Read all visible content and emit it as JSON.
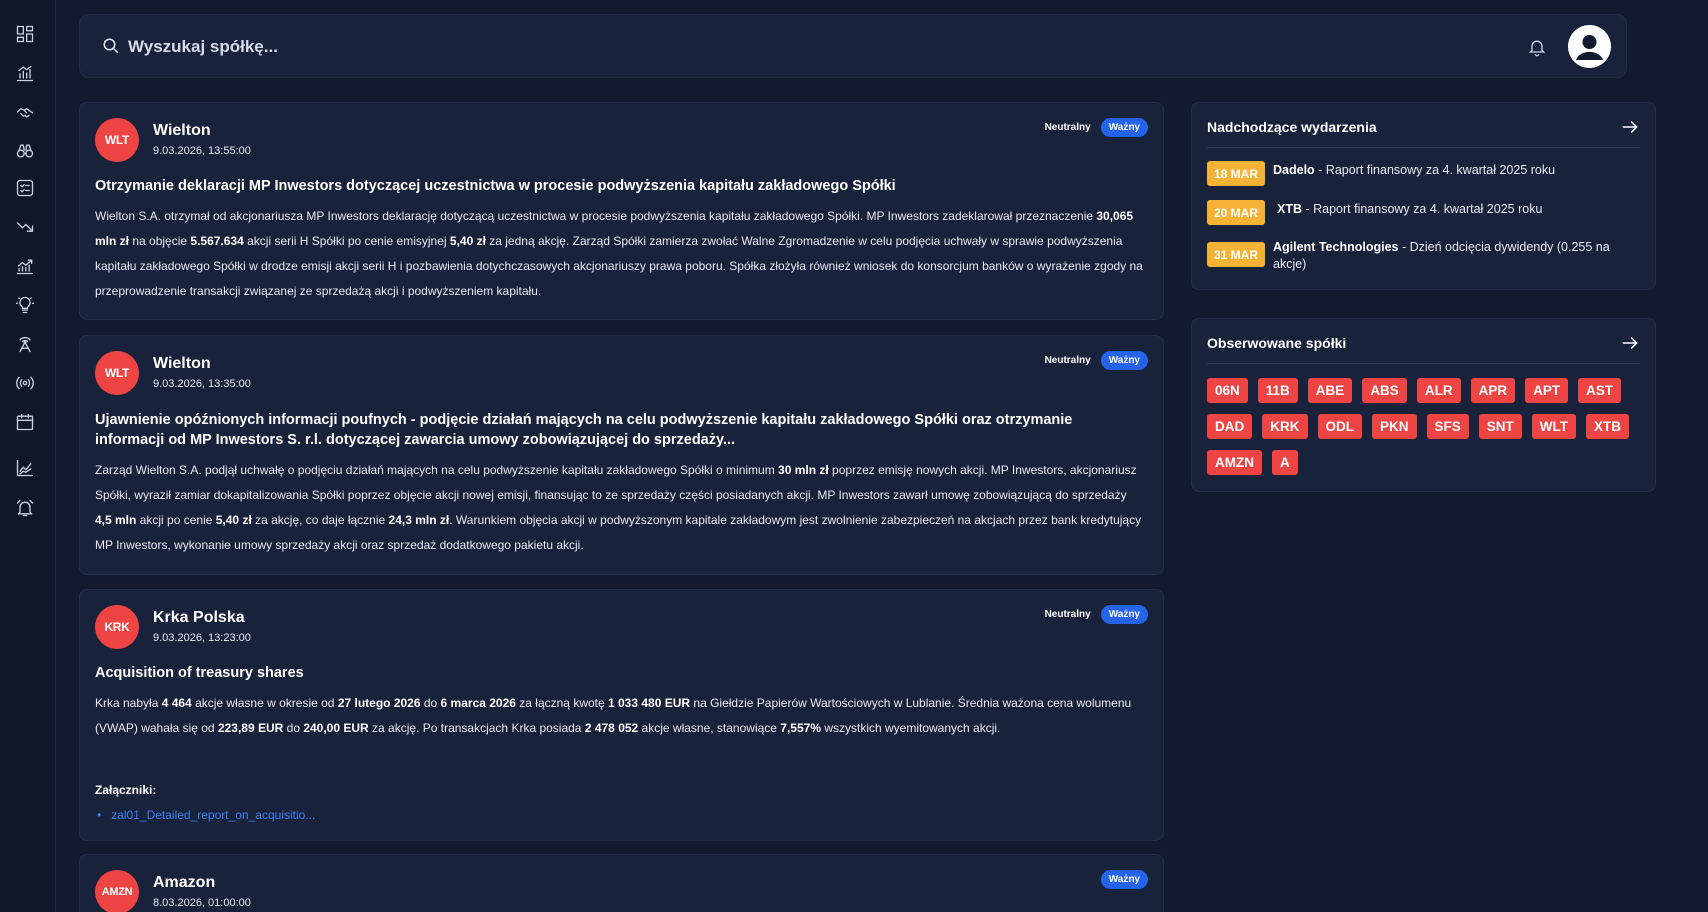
{
  "search": {
    "placeholder": "Wyszukaj spółkę..."
  },
  "sidebar": {
    "icons": [
      "dashboard-icon",
      "bar-chart-icon",
      "handshake-icon",
      "binoculars-icon",
      "checklist-icon",
      "trend-down-icon",
      "trend-up-icon",
      "lightbulb-icon",
      "radar-tower-icon",
      "broadcast-icon",
      "calendar-icon",
      "area-chart-icon",
      "bell-alarm-icon"
    ]
  },
  "feed": [
    {
      "logo": "WLT",
      "company": "Wielton",
      "date": "9.03.2026, 13:55:00",
      "sentiment": "Neutralny",
      "importance": "Ważny",
      "title": "Otrzymanie deklaracji MP Inwestors dotyczącej uczestnictwa w procesie podwyższenia kapitału zakładowego Spółki",
      "body": [
        {
          "t": "Wielton S.A. otrzymał od akcjonariusza MP Inwestors deklarację dotyczącą uczestnictwa w procesie podwyższenia kapitału zakładowego Spółki. MP Inwestors zadeklarował przeznaczenie ",
          "b": false
        },
        {
          "t": "30,065 mln zł",
          "b": true
        },
        {
          "t": " na objęcie ",
          "b": false
        },
        {
          "t": "5.567.634",
          "b": true
        },
        {
          "t": " akcji serii H Spółki po cenie emisyjnej ",
          "b": false
        },
        {
          "t": "5,40 zł",
          "b": true
        },
        {
          "t": " za jedną akcję. Zarząd Spółki zamierza zwołać Walne Zgromadzenie w celu podjęcia uchwały w sprawie podwyższenia kapitału zakładowego Spółki w drodze emisji akcji serii H i pozbawienia dotychczasowych akcjonariuszy prawa poboru. Spółka złożyła również wniosek do konsorcjum banków o wyrażenie zgody na przeprowadzenie transakcji związanej ze sprzedażą akcji i podwyższeniem kapitału.",
          "b": false
        }
      ]
    },
    {
      "logo": "WLT",
      "company": "Wielton",
      "date": "9.03.2026, 13:35:00",
      "sentiment": "Neutralny",
      "importance": "Ważny",
      "title": "Ujawnienie opóźnionych informacji poufnych - podjęcie działań mających na celu podwyższenie kapitału zakładowego Spółki oraz otrzymanie informacji od MP Inwestors S. r.l. dotyczącej zawarcia umowy zobowiązującej do sprzedaży...",
      "body": [
        {
          "t": "Zarząd Wielton S.A. podjął uchwałę o podjęciu działań mających na celu podwyższenie kapitału zakładowego Spółki o minimum ",
          "b": false
        },
        {
          "t": "30 mln zł",
          "b": true
        },
        {
          "t": " poprzez emisję nowych akcji. MP Inwestors, akcjonariusz Spółki, wyraził zamiar dokapitalizowania Spółki poprzez objęcie akcji nowej emisji, finansując to ze sprzedaży części posiadanych akcji. MP Inwestors zawarł umowę zobowiązującą do sprzedaży ",
          "b": false
        },
        {
          "t": "4,5 mln",
          "b": true
        },
        {
          "t": " akcji po cenie ",
          "b": false
        },
        {
          "t": "5,40 zł",
          "b": true
        },
        {
          "t": " za akcję, co daje łącznie ",
          "b": false
        },
        {
          "t": "24,3 mln zł",
          "b": true
        },
        {
          "t": ". Warunkiem objęcia akcji w podwyższonym kapitale zakładowym jest zwolnienie zabezpieczeń na akcjach przez bank kredytujący MP Inwestors, wykonanie umowy sprzedaży akcji oraz sprzedaż dodatkowego pakietu akcji.",
          "b": false
        }
      ]
    },
    {
      "logo": "KRK",
      "company": "Krka Polska",
      "date": "9.03.2026, 13:23:00",
      "sentiment": "Neutralny",
      "importance": "Ważny",
      "title": "Acquisition of treasury shares",
      "body": [
        {
          "t": "Krka nabyła ",
          "b": false
        },
        {
          "t": "4 464",
          "b": true
        },
        {
          "t": " akcje własne w okresie od ",
          "b": false
        },
        {
          "t": "27 lutego 2026",
          "b": true
        },
        {
          "t": " do ",
          "b": false
        },
        {
          "t": "6 marca 2026",
          "b": true
        },
        {
          "t": " za łączną kwotę ",
          "b": false
        },
        {
          "t": "1 033 480 EUR",
          "b": true
        },
        {
          "t": " na Giełdzie Papierów Wartościowych w Lublanie. Średnia ważona cena wolumenu (VWAP) wahała się od ",
          "b": false
        },
        {
          "t": "223,89 EUR",
          "b": true
        },
        {
          "t": " do ",
          "b": false
        },
        {
          "t": "240,00 EUR",
          "b": true
        },
        {
          "t": " za akcję. Po transakcjach Krka posiada ",
          "b": false
        },
        {
          "t": "2 478 052",
          "b": true
        },
        {
          "t": " akcje własne, stanowiące ",
          "b": false
        },
        {
          "t": "7,557%",
          "b": true
        },
        {
          "t": " wszystkich wyemitowanych akcji.",
          "b": false
        }
      ],
      "attachments_label": "Załączniki:",
      "attachments": [
        "zal01_Detailed_report_on_acquisitio..."
      ]
    },
    {
      "logo": "AMZN",
      "company": "Amazon",
      "date": "8.03.2026, 01:00:00",
      "sentiment": "",
      "importance": "Ważny"
    }
  ],
  "events": {
    "title": "Nadchodzące wydarzenia",
    "items": [
      {
        "date": "18 MAR",
        "company": "Dadelo",
        "text": " - Raport finansowy za 4. kwartał 2025 roku"
      },
      {
        "date": "20 MAR",
        "company": "XTB",
        "text": " - Raport finansowy za 4. kwartał 2025 roku"
      },
      {
        "date": "31 MAR",
        "company": "Agilent Technologies",
        "text": " - Dzień odcięcia dywidendy (0.255 na akcje)"
      }
    ]
  },
  "watchlist": {
    "title": "Obserwowane spółki",
    "tickers": [
      "06N",
      "11B",
      "ABE",
      "ABS",
      "ALR",
      "APR",
      "APT",
      "AST",
      "DAD",
      "KRK",
      "ODL",
      "PKN",
      "SFS",
      "SNT",
      "WLT",
      "XTB",
      "AMZN",
      "A"
    ]
  },
  "colors": {
    "background": "#111a2e",
    "card": "#18223a",
    "logo": "#ef4444",
    "important": "#2563eb",
    "event_date": "#f5b335",
    "link": "#3b82f6"
  }
}
